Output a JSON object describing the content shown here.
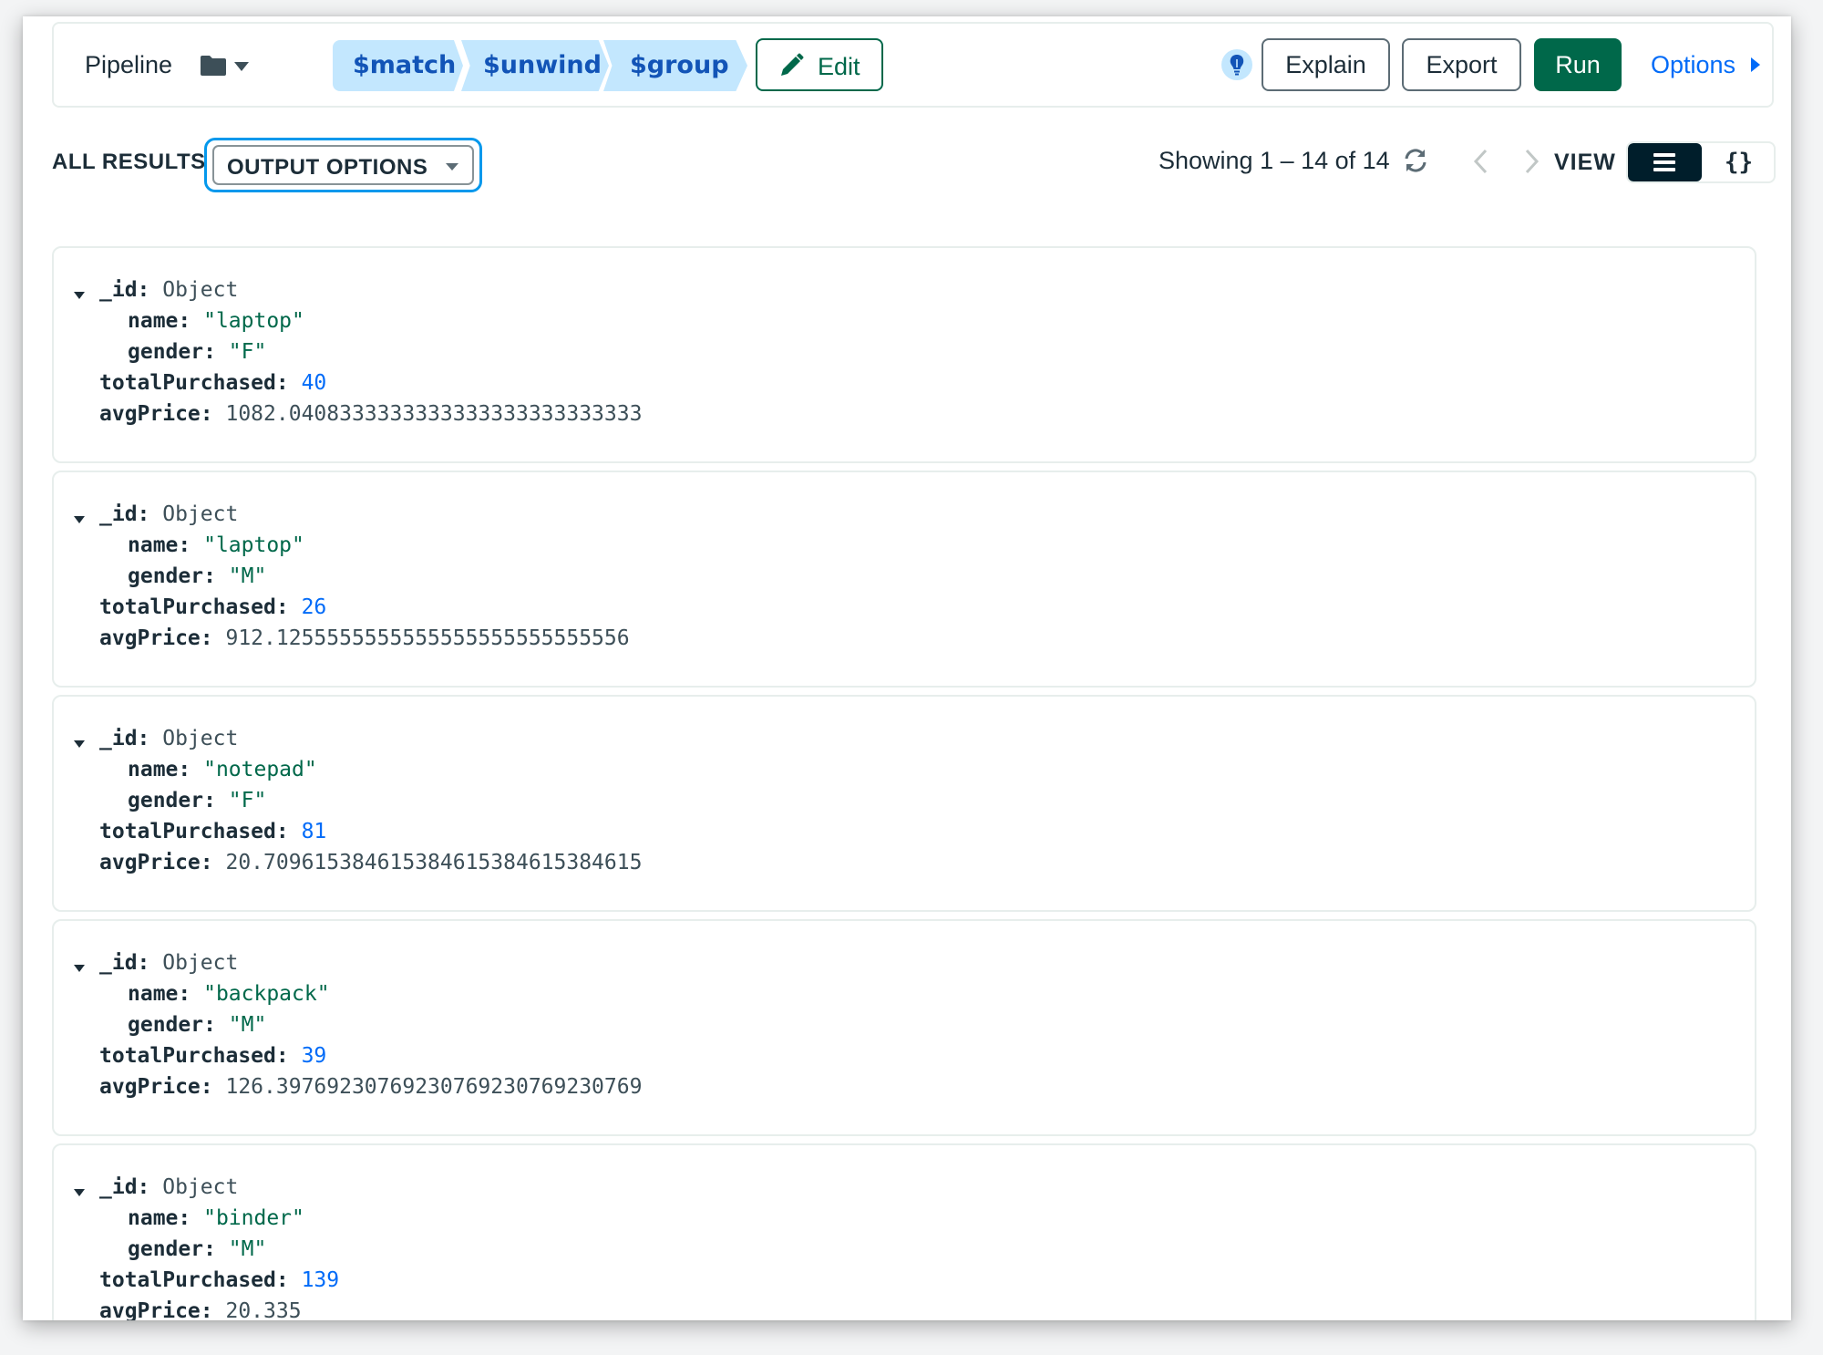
{
  "toolbar": {
    "pipeline_label": "Pipeline",
    "stages": [
      "$match",
      "$unwind",
      "$group"
    ],
    "edit_label": "Edit",
    "explain_label": "Explain",
    "export_label": "Export",
    "run_label": "Run",
    "options_label": "Options"
  },
  "results": {
    "all_results_label": "ALL RESULTS",
    "output_options_label": "OUTPUT OPTIONS",
    "showing_text": "Showing 1 – 14 of 14",
    "view_label": "VIEW",
    "json_view_glyph": "{}"
  },
  "documents": [
    {
      "name": "\"laptop\"",
      "gender": "\"F\"",
      "totalPurchased": "40",
      "avgPrice": "1082.0408333333333333333333333333"
    },
    {
      "name": "\"laptop\"",
      "gender": "\"M\"",
      "totalPurchased": "26",
      "avgPrice": "912.1255555555555555555555555556"
    },
    {
      "name": "\"notepad\"",
      "gender": "\"F\"",
      "totalPurchased": "81",
      "avgPrice": "20.709615384615384615384615384615"
    },
    {
      "name": "\"backpack\"",
      "gender": "\"M\"",
      "totalPurchased": "39",
      "avgPrice": "126.39769230769230769230769230769"
    },
    {
      "name": "\"binder\"",
      "gender": "\"M\"",
      "totalPurchased": "139",
      "avgPrice": "20.335"
    }
  ],
  "fields": {
    "id_key": "_id",
    "id_value": "Object",
    "name_key": "name",
    "gender_key": "gender",
    "total_key": "totalPurchased",
    "avg_key": "avgPrice"
  },
  "colors": {
    "accent_green": "#00684a",
    "stage_bg": "#c3e7fe",
    "stage_text": "#1254b7",
    "link_blue": "#016bf8",
    "focus_ring": "#0498ec",
    "dark": "#001e2b"
  }
}
